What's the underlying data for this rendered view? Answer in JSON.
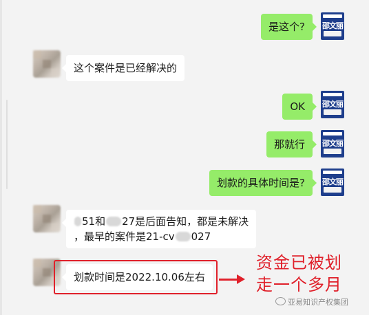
{
  "brand_avatar_text": "邵文丽",
  "messages": [
    {
      "side": "out",
      "text": "是这个?"
    },
    {
      "side": "in",
      "text": "这个案件是已经解决的"
    },
    {
      "side": "out",
      "text": "OK"
    },
    {
      "side": "out",
      "text": "那就行"
    },
    {
      "side": "out",
      "text": "划款的具体时间是?"
    },
    {
      "side": "in",
      "line1_a": "51和",
      "line1_b": "27是后面告知，都是未解决",
      "line2_a": "，最早的案件是21-cv",
      "line2_b": "027"
    },
    {
      "side": "in",
      "text": "划款时间是2022.10.06左右"
    }
  ],
  "annotation": {
    "line1": "资金已被划",
    "line2": "走一个多月",
    "color": "#e0202a"
  },
  "watermark": "亚易知识产权集团",
  "colors": {
    "out_bubble": "#95ec69",
    "in_bubble": "#ffffff",
    "background": "#f3f3f3",
    "brand_avatar": "#1e3e8c"
  }
}
